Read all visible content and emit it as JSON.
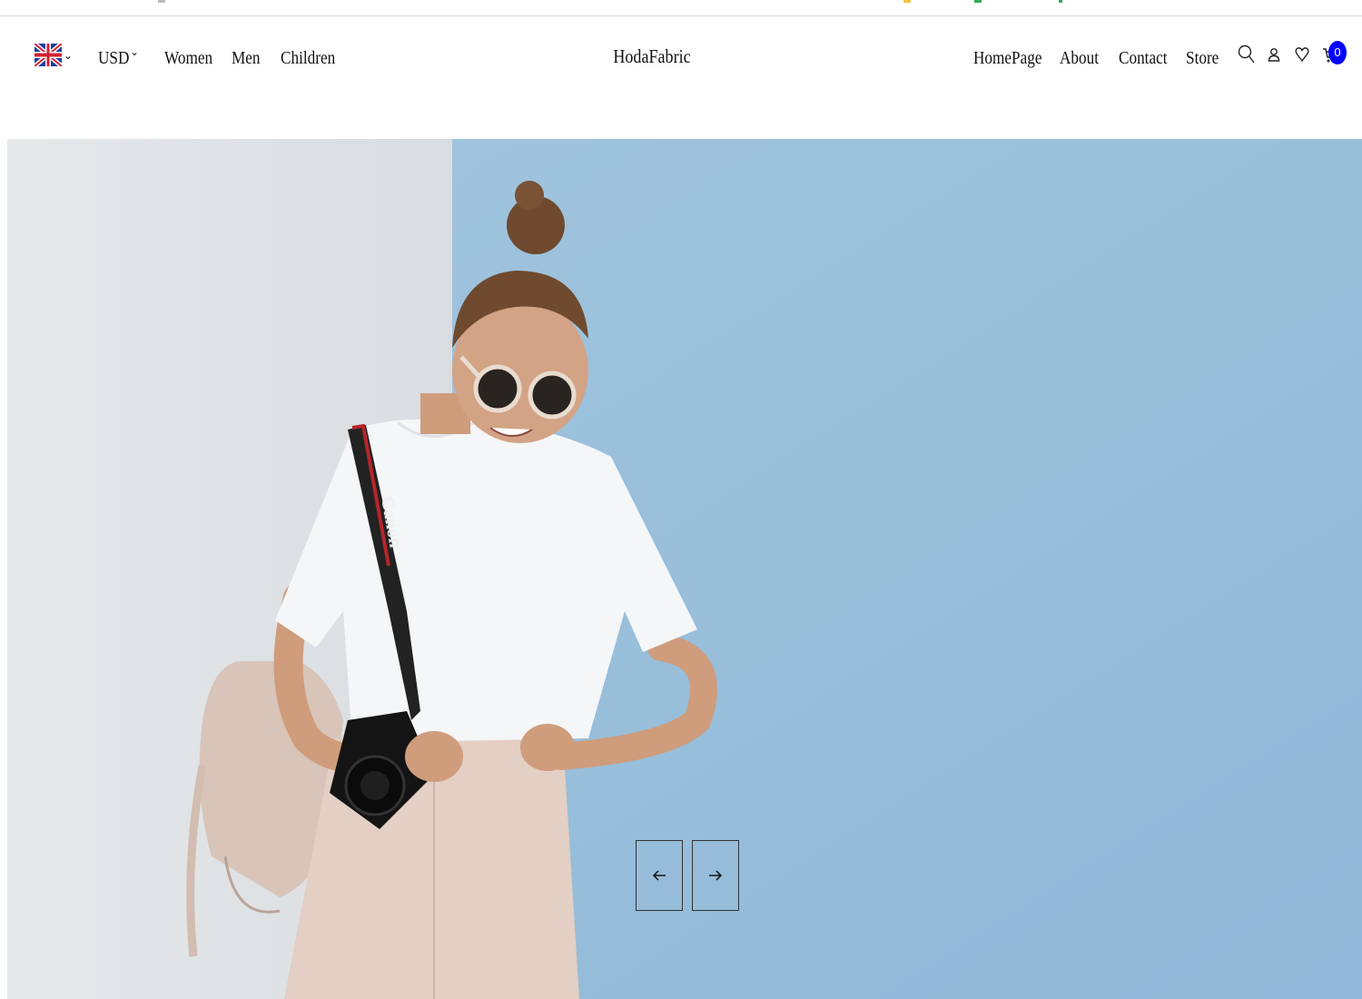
{
  "header": {
    "language_flag": "uk-flag-icon",
    "currency": "USD",
    "left_nav": [
      {
        "label": "Women"
      },
      {
        "label": "Men"
      },
      {
        "label": "Children"
      }
    ],
    "logo": "HodaFabric",
    "right_nav": [
      {
        "label": "HomePage"
      },
      {
        "label": "About"
      },
      {
        "label": "Contact"
      },
      {
        "label": "Store"
      }
    ],
    "icons": [
      "search-icon",
      "user-icon",
      "heart-icon",
      "cart-icon"
    ],
    "cart_count": "0"
  },
  "hero": {
    "image": "woman-with-camera-photo",
    "prev_icon": "arrow-left-icon",
    "next_icon": "arrow-right-icon"
  },
  "colors": {
    "badge": "#0000ff",
    "wall_blue": "#a9c8e0",
    "wall_white": "#e3e6e9"
  }
}
